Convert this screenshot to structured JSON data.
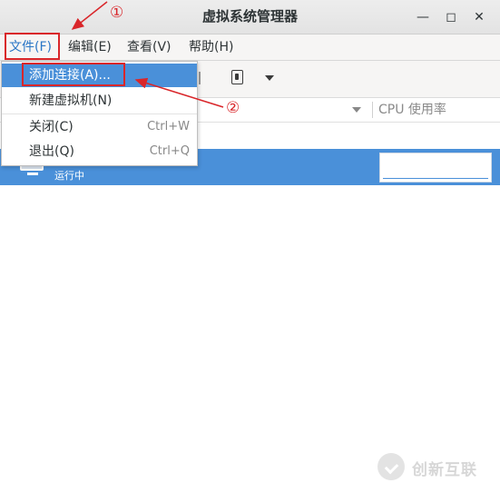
{
  "window": {
    "title": "虚拟系统管理器",
    "controls": {
      "minimize": "—",
      "maximize": "◻",
      "close": "✕"
    }
  },
  "menubar": {
    "file": "文件(F)",
    "edit": "编辑(E)",
    "view": "查看(V)",
    "help": "帮助(H)"
  },
  "columns": {
    "cpu": "CPU 使用率"
  },
  "vm_list": {
    "vm_status": "运行中"
  },
  "file_menu": {
    "items": [
      {
        "label": "添加连接(A)...",
        "accel": ""
      },
      {
        "label": "新建虚拟机(N)",
        "accel": ""
      },
      {
        "label": "关闭(C)",
        "accel": "Ctrl+W"
      },
      {
        "label": "退出(Q)",
        "accel": "Ctrl+Q"
      }
    ]
  },
  "annotations": {
    "step1": "①",
    "step2": "②",
    "color": "#d9262a"
  },
  "watermark": {
    "text": "创新互联"
  },
  "colors": {
    "accent": "#4a90d9",
    "menu_active_text": "#2a76c6"
  }
}
